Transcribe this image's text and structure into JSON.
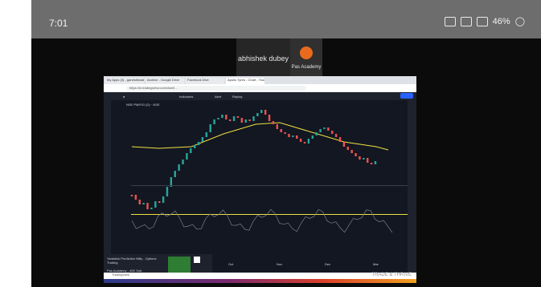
{
  "status": {
    "time": "7:01",
    "battery": "46%"
  },
  "participants": [
    {
      "name": "abhishek dubey"
    },
    {
      "name": "Pas Academy"
    }
  ],
  "browser": {
    "tabs": [
      "My Apps (3) - ganeshtrader...",
      "Archive - Google Drive",
      "Facebook Dive",
      "Apollo Tyres - Chart - TradingView"
    ],
    "address": "https://in.tradingview.com/chart/…"
  },
  "tradingview": {
    "symbol": "NSE PMIF/G (D) · NSE",
    "indicators_label": "Indicators",
    "alert_label": "Alert",
    "replay_label": "Replay",
    "publish_label": "Publish",
    "bottom_left": "Taraftaran Tradeing",
    "time_readout": "15:03:33 (UTC+5:30)",
    "bottom_right": "adj",
    "news": {
      "title": "Yardstick Prediction Nifty - Options Trading",
      "sub": "Pas Academy - 40K Sub.",
      "button": "Subscribe"
    },
    "months": [
      "Oct",
      "Nov",
      "Dec",
      "Mar"
    ],
    "footer_brand": "TradingView",
    "footer_tagline": "TRADE & THRIVE"
  },
  "chart_data": {
    "type": "line",
    "title": "",
    "series": [
      {
        "name": "",
        "color": "#ef5350"
      },
      {
        "name": "",
        "color": "#f0e040"
      }
    ]
  }
}
